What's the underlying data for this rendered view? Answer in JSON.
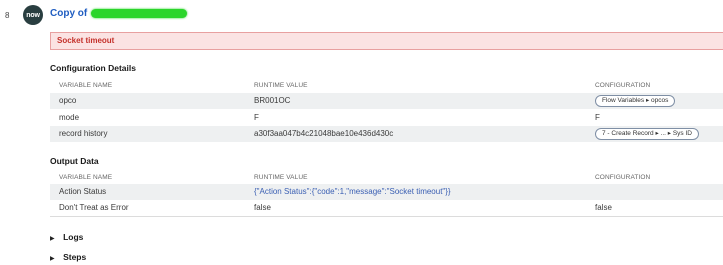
{
  "step": {
    "number": "8",
    "badge_text": "now",
    "title": "Copy of"
  },
  "error_banner": "Socket timeout",
  "configuration": {
    "heading": "Configuration Details",
    "columns": [
      "VARIABLE NAME",
      "RUNTIME VALUE",
      "CONFIGURATION"
    ],
    "rows": [
      {
        "name": "opco",
        "value": "BR001OC",
        "config": "Flow Variables ▸ opcos",
        "config_type": "pill"
      },
      {
        "name": "mode",
        "value": "F",
        "config": "F",
        "config_type": "text"
      },
      {
        "name": "record history",
        "value": "a30f3aa047b4c21048bae10e436d430c",
        "config": "7 - Create Record ▸ ... ▸ Sys ID",
        "config_type": "pill"
      }
    ]
  },
  "output": {
    "heading": "Output Data",
    "columns": [
      "VARIABLE NAME",
      "RUNTIME VALUE",
      "CONFIGURATION"
    ],
    "rows": [
      {
        "name": "Action Status",
        "value": "{\"Action Status\":{\"code\":1,\"message\":\"Socket timeout\"}}",
        "config": ""
      },
      {
        "name": "Don't Treat as Error",
        "value": "false",
        "config": "false"
      }
    ]
  },
  "collapsibles": {
    "logs": "Logs",
    "steps": "Steps"
  },
  "colors": {
    "link": "#1f5dc1",
    "error_bg": "#fbe3e3",
    "error_text": "#c4312b",
    "badge": "#293e40",
    "row_shade": "#eef0f1"
  }
}
